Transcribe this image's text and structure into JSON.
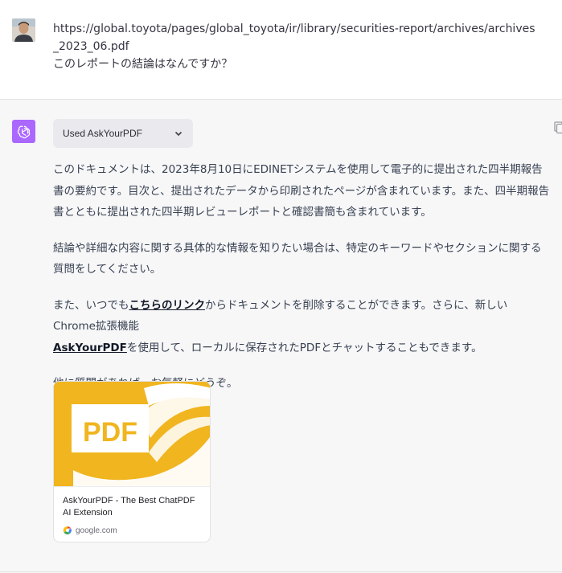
{
  "user": {
    "message_url": "https://global.toyota/pages/global_toyota/ir/library/securities-report/archives/archives_2023_06.pdf",
    "message_question": "このレポートの結論はなんですか？"
  },
  "assistant": {
    "plugin_chip_label": "Used AskYourPDF",
    "paragraphs": {
      "p1": "このドキュメントは、2023年8月10日にEDINETシステムを使用して電子的に提出された四半期報告書の要約です。目次と、提出されたデータから印刷されたページが含まれています。また、四半期報告書とともに提出された四半期レビューレポートと確認書簡も含まれています。",
      "p2": "結論や詳細な内容に関する具体的な情報を知りたい場合は、特定のキーワードやセクションに関する質問をしてください。",
      "p3_before_link": "また、いつでも",
      "p3_link": "こちらのリンク",
      "p3_after_link": "からドキュメントを削除することができます。さらに、新しいChrome拡張機能",
      "p3_link2": "AskYourPDF",
      "p3_end": "を使用して、ローカルに保存されたPDFとチャットすることもできます。",
      "p4": "他に質問があれば、お気軽にどうぞ。"
    },
    "card": {
      "thumb_text": "PDF",
      "title": "AskYourPDF - The Best ChatPDF AI Extension",
      "source": "google.com"
    }
  },
  "colors": {
    "bot_avatar": "#ab68ff",
    "thumb_bg": "#f0b51f",
    "panel_bg": "#f7f7f8"
  },
  "icons": {
    "user_avatar": "user-photo",
    "bot_avatar": "openai-logo-icon",
    "chip": "chevron-down-icon",
    "copy": "copy-icon",
    "source": "google-icon"
  }
}
